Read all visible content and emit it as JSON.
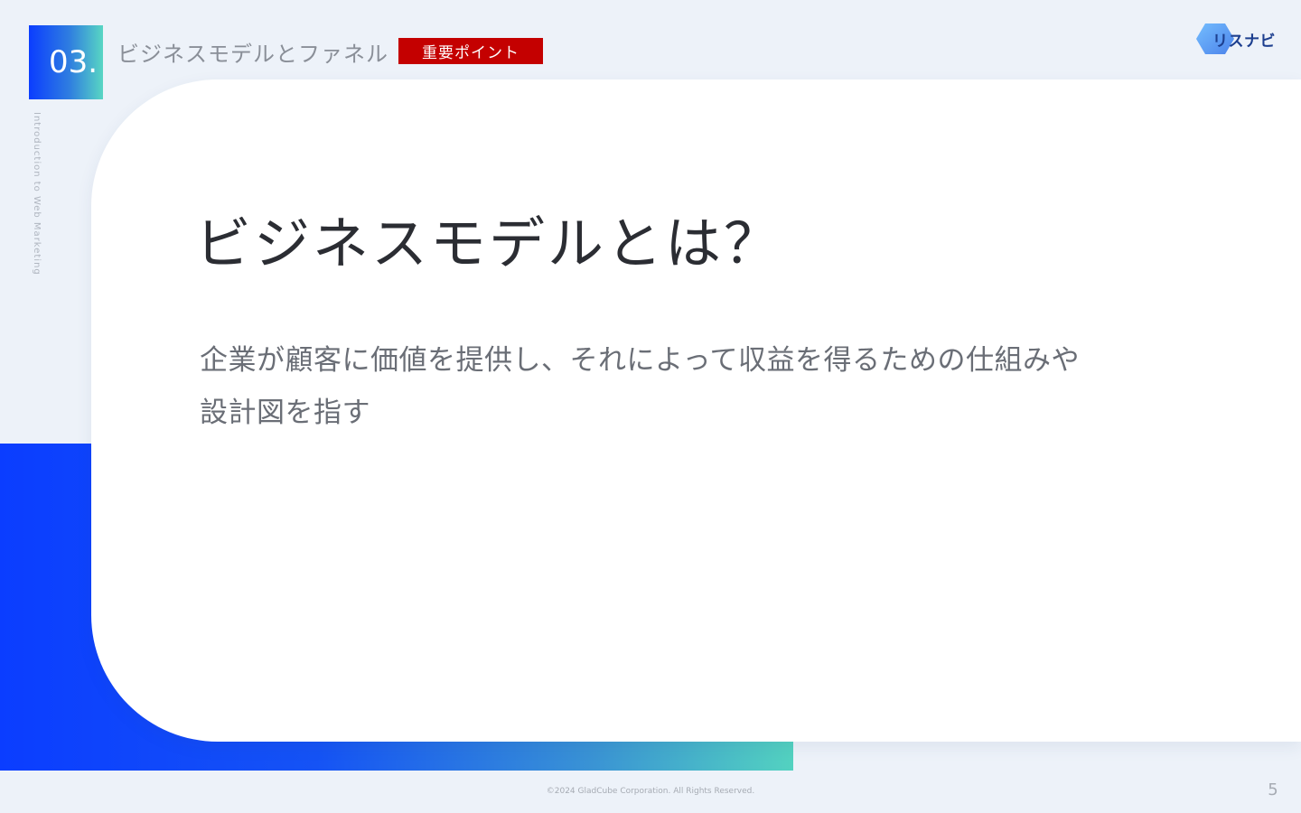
{
  "header": {
    "section_number": "03.",
    "section_title": "ビジネスモデルとファネル",
    "badge": "重要ポイント",
    "vertical_label": "Introduction to Web Marketing",
    "logo_text": "リスナビ"
  },
  "content": {
    "heading": "ビジネスモデルとは？",
    "body_line1": "企業が顧客に価値を提供し、それによって収益を得るための仕組みや",
    "body_line2": "設計図を指す"
  },
  "footer": {
    "copyright": "©2024 GladCube Corporation. All Rights Reserved.",
    "page_number": "5"
  },
  "colors": {
    "accent_blue": "#0b3dff",
    "accent_teal": "#53d2c0",
    "badge_red": "#c40000",
    "background": "#edf2f9"
  }
}
